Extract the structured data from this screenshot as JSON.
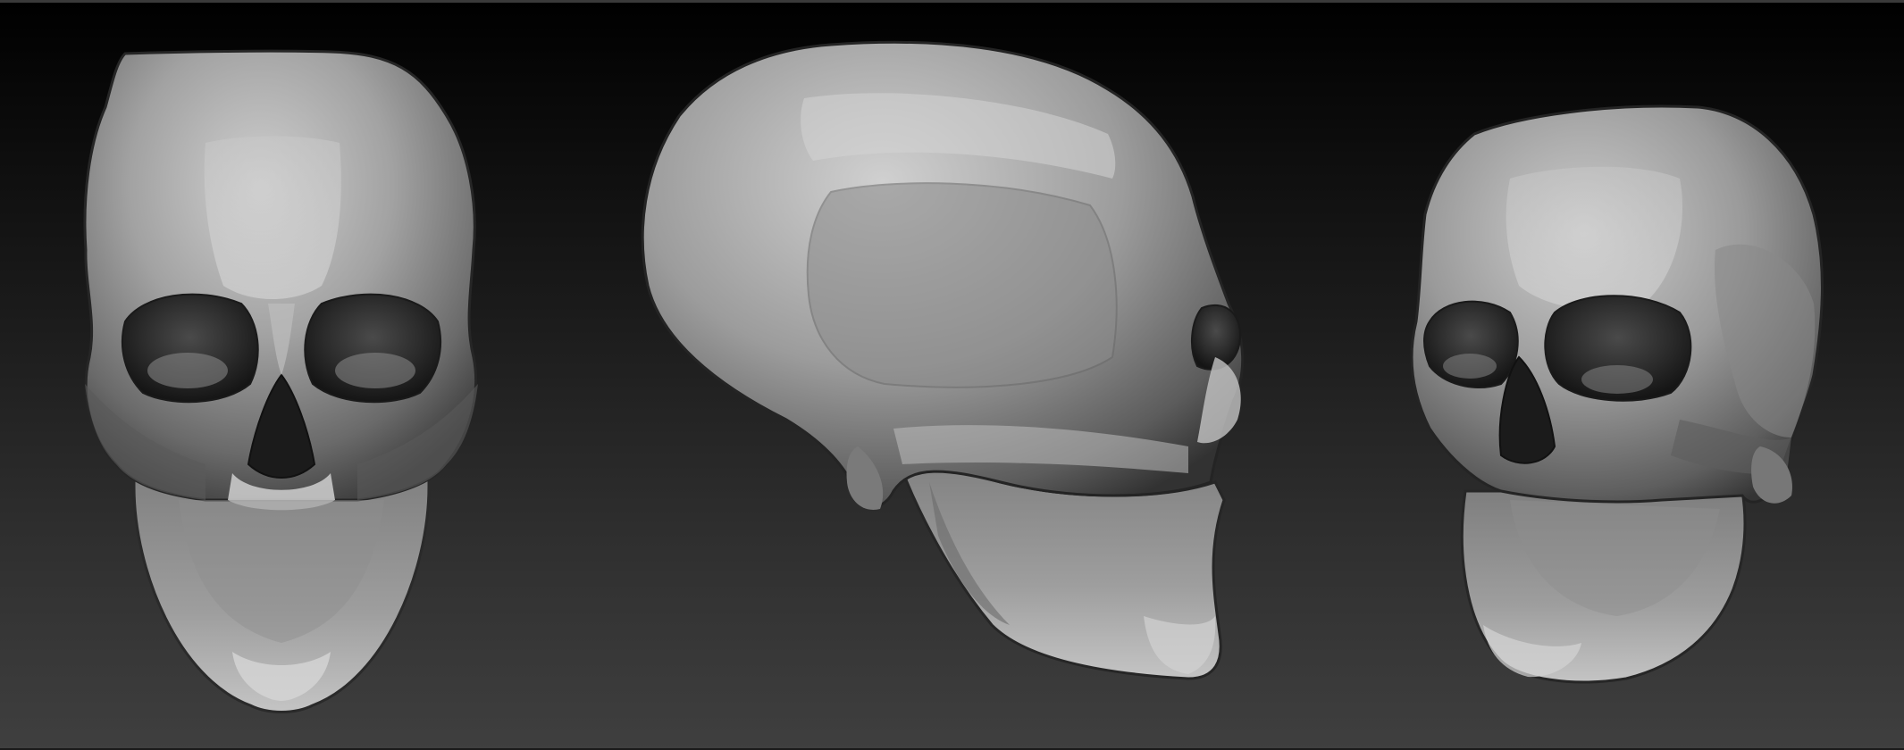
{
  "scene": {
    "background_top_color": "#000000",
    "background_bottom_color": "#3f3f3f",
    "material_light": "#b9b9b9",
    "material_mid": "#8a8a8a",
    "material_dark": "#3a3a3a"
  },
  "views": [
    {
      "id": "front",
      "icon": "skull-front-view"
    },
    {
      "id": "side",
      "icon": "skull-side-view"
    },
    {
      "id": "three-quarter",
      "icon": "skull-three-quarter-view"
    }
  ]
}
